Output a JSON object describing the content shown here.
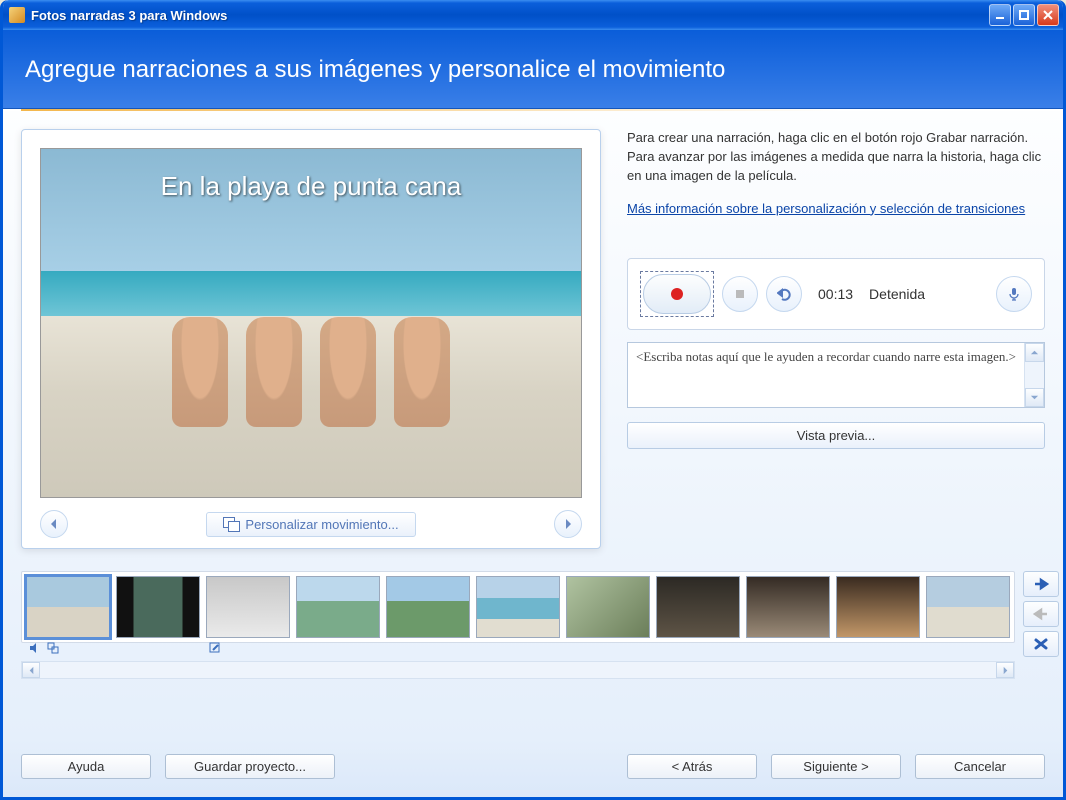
{
  "window": {
    "title": "Fotos narradas 3 para Windows"
  },
  "header": {
    "title": "Agregue narraciones a sus imágenes y personalice el movimiento"
  },
  "preview": {
    "caption": "En la playa de punta cana",
    "customize_label": "Personalizar movimiento..."
  },
  "instructions": {
    "text": "Para crear una narración, haga clic en el botón rojo Grabar narración. Para avanzar por las imágenes a medida que narra la historia, haga clic en una imagen de la película.",
    "link": "Más información sobre la personalización y selección de transiciones"
  },
  "recorder": {
    "time": "00:13",
    "status": "Detenida",
    "notes_value": "<Escriba notas aquí que le ayuden a recordar cuando narre esta imagen.>",
    "preview_btn": "Vista previa..."
  },
  "filmstrip": {
    "thumbs": 11,
    "selected_index": 0
  },
  "footer": {
    "help": "Ayuda",
    "save": "Guardar proyecto...",
    "back": "< Atrás",
    "next": "Siguiente >",
    "cancel": "Cancelar"
  }
}
